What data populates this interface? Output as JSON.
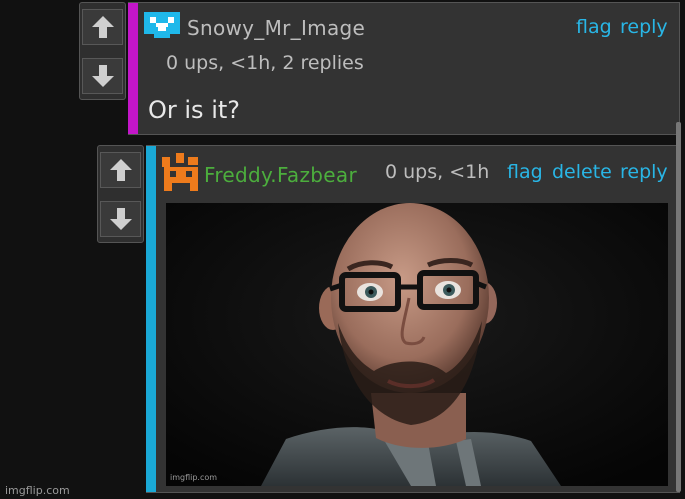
{
  "comment1": {
    "username": "Snowy_Mr_Image",
    "meta": "0 ups, <1h, 2 replies",
    "text": "Or is it?",
    "actions": {
      "flag": "flag",
      "reply": "reply"
    },
    "avatar_icon": "pixel-face-icon",
    "stripe_color": "#c316c9",
    "username_color": "#bdbdbd"
  },
  "comment2": {
    "username": "Freddy.Fazbear",
    "meta": "0 ups, <1h",
    "actions": {
      "flag": "flag",
      "delete": "delete",
      "reply": "reply"
    },
    "avatar_icon": "pixel-creature-icon",
    "stripe_color": "#1aa9d6",
    "username_color": "#4cae3d",
    "image": {
      "watermark": "imgflip.com"
    }
  },
  "page": {
    "watermark": "imgflip.com"
  },
  "colors": {
    "link": "#29b6e6",
    "background": "#111111",
    "panel": "#333333"
  }
}
